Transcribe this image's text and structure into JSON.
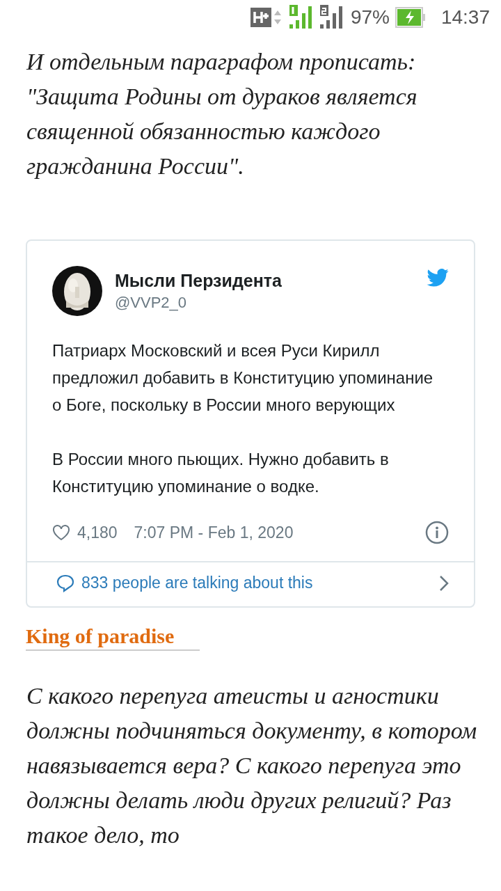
{
  "status_bar": {
    "battery_percent": "97%",
    "time": "14:37"
  },
  "intro_paragraph": "И отдельным параграфом прописать: \"Защита Родины от дураков является священной обязанностью каждого гражданина России\".",
  "tweet": {
    "author_name": "Мысли Перзидента",
    "handle": "@VVP2_0",
    "paragraphs": [
      "Патриарх Московский и всея Руси Кирилл предложил добавить в Конституцию упоминание о Боге, поскольку в России много верующих",
      "В России много пьющих. Нужно добавить в Конституцию упоминание о водке."
    ],
    "likes": "4,180",
    "timestamp": "7:07 PM - Feb 1, 2020",
    "discussion_link": "833 people are talking about this"
  },
  "comment": {
    "author": "King of paradise",
    "text": "С какого перепуга атеисты и агностики должны подчиняться документу, в котором навязывается вера? С какого перепуга это должны делать люди других религий? Раз такое дело, то"
  }
}
